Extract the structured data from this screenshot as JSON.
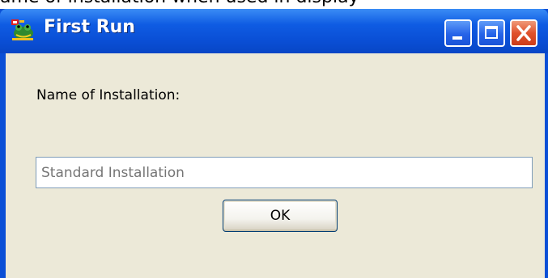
{
  "background": {
    "partial_text": "ame of installation when used in display"
  },
  "window": {
    "title": "First Run",
    "icon": "frog-app-icon",
    "controls": {
      "minimize": "minimize-icon",
      "maximize": "maximize-icon",
      "close": "close-icon"
    }
  },
  "form": {
    "label": "Name of Installation:",
    "input_placeholder": "Standard Installation",
    "input_value": "",
    "ok_label": "OK"
  },
  "colors": {
    "titlebar": "#0a4fd6",
    "client_bg": "#ece9d8",
    "close_button": "#e0522c",
    "input_border": "#7f9db9",
    "placeholder": "#a0a0a0"
  }
}
